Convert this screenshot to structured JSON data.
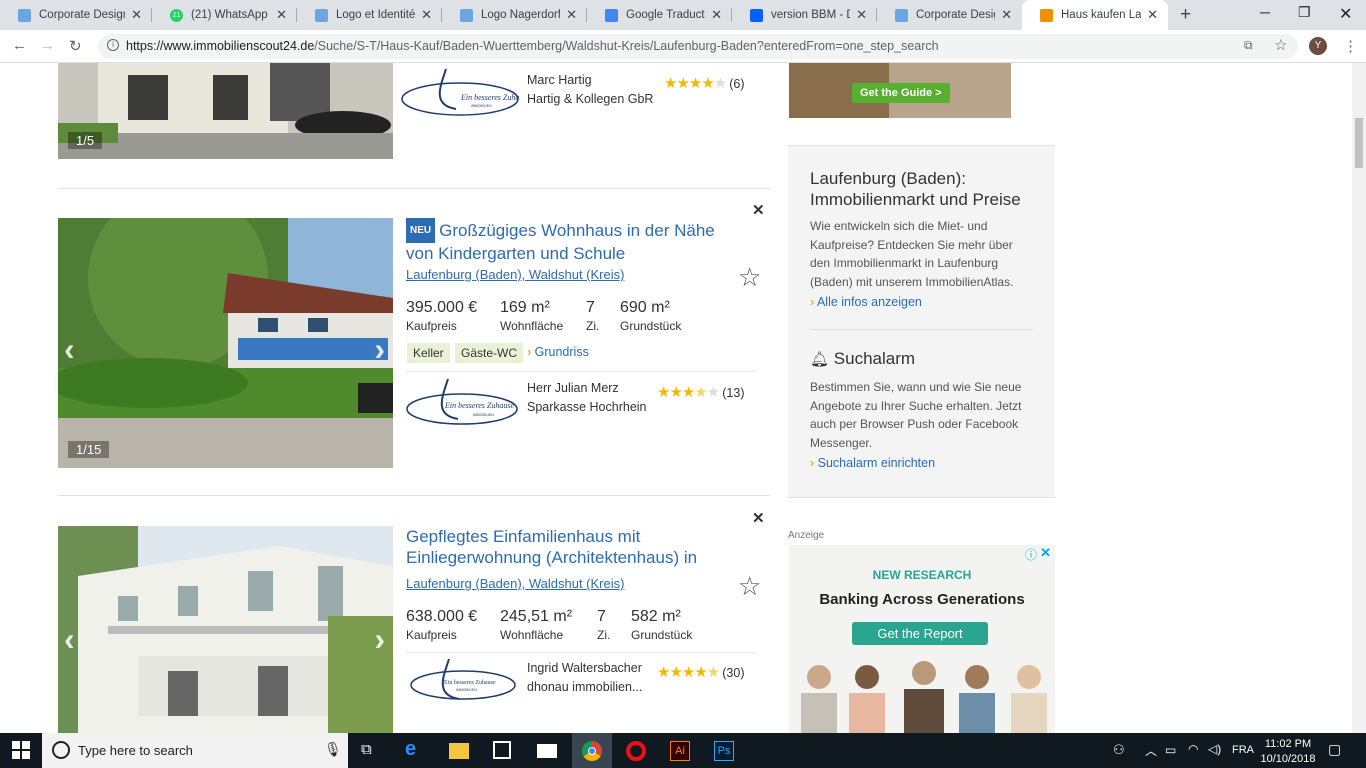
{
  "tabs": [
    {
      "title": "Corporate Design",
      "color": "#4a8fd4"
    },
    {
      "title": "(21) WhatsApp",
      "color": "#25d366"
    },
    {
      "title": "Logo et Identité de",
      "color": "#4a8fd4"
    },
    {
      "title": "Logo Nagerdorf fü",
      "color": "#4a8fd4"
    },
    {
      "title": "Google Traduction",
      "color": "#4285f4"
    },
    {
      "title": "version BBM - Dro",
      "color": "#0061fe"
    },
    {
      "title": "Corporate Design",
      "color": "#4a8fd4"
    },
    {
      "title": "Haus kaufen Laufe",
      "color": "#f28f00"
    }
  ],
  "whatsapp_badge": "21",
  "url": {
    "domain": "https://www.immobilienscout24.de",
    "path": "/Suche/S-T/Haus-Kauf/Baden-Wuerttemberg/Waldshut-Kreis/Laufenburg-Baden?enteredFrom=one_step_search"
  },
  "profile_initial": "Y",
  "listings": [
    {
      "photo_count": "1/5",
      "agent_name": "Marc Hartig",
      "agent_company": "Hartig & Kollegen GbR",
      "rating": 4,
      "rating_count": "(6)",
      "logo_text": "Ein besseres Zuhause",
      "logo_sub": "IMMOBILIEN"
    },
    {
      "photo_count": "1/15",
      "badge": "NEU",
      "title": "Großzügiges Wohnhaus in der Nähe von Kindergarten und Schule",
      "location": "Laufenburg (Baden), Waldshut (Kreis)",
      "price": "395.000 €",
      "price_label": "Kaufpreis",
      "area": "169 m²",
      "area_label": "Wohnfläche",
      "rooms": "7",
      "rooms_label": "Zi.",
      "plot": "690 m²",
      "plot_label": "Grundstück",
      "tags": [
        "Keller",
        "Gäste-WC"
      ],
      "floorplan_link": "Grundriss",
      "agent_name": "Herr Julian Merz",
      "agent_company": "Sparkasse Hochrhein",
      "rating": 3.5,
      "rating_count": "(13)",
      "logo_text": "Ein besseres Zuhause",
      "logo_sub": "IMMOBILIEN"
    },
    {
      "title": "Gepflegtes Einfamilienhaus mit Einliegerwohnung (Architektenhaus) in",
      "location": "Laufenburg (Baden), Waldshut (Kreis)",
      "price": "638.000 €",
      "price_label": "Kaufpreis",
      "area": "245,51 m²",
      "area_label": "Wohnfläche",
      "rooms": "7",
      "rooms_label": "Zi.",
      "plot": "582 m²",
      "plot_label": "Grundstück",
      "agent_name": "Ingrid Waltersbacher",
      "agent_company": "dhonau immobilien...",
      "rating": 4.5,
      "rating_count": "(30)",
      "logo_text": "Ein besseres Zuhause",
      "logo_sub": "IMMOBILIEN"
    }
  ],
  "sidebar": {
    "guide_button": "Get the Guide >",
    "market_title": "Laufenburg (Baden): Immobilienmarkt und Preise",
    "market_text": "Wie entwickeln sich die Miet- und Kaufpreise? Entdecken Sie mehr über den Immobilienmarkt in Laufenburg (Baden) mit unserem ImmobilienAtlas.",
    "market_link": "Alle infos anzeigen",
    "alarm_title": "Suchalarm",
    "alarm_text": "Bestimmen Sie, wann und wie Sie neue Angebote zu Ihrer Suche erhalten. Jetzt auch per Browser Push oder Facebook Messenger.",
    "alarm_link": "Suchalarm einrichten",
    "ad_label": "Anzeige"
  },
  "ad": {
    "eyebrow": "NEW RESEARCH",
    "headline": "Banking Across Generations",
    "button": "Get the Report"
  },
  "taskbar": {
    "search_placeholder": "Type here to search",
    "lang": "FRA",
    "time": "11:02 PM",
    "date": "10/10/2018"
  }
}
